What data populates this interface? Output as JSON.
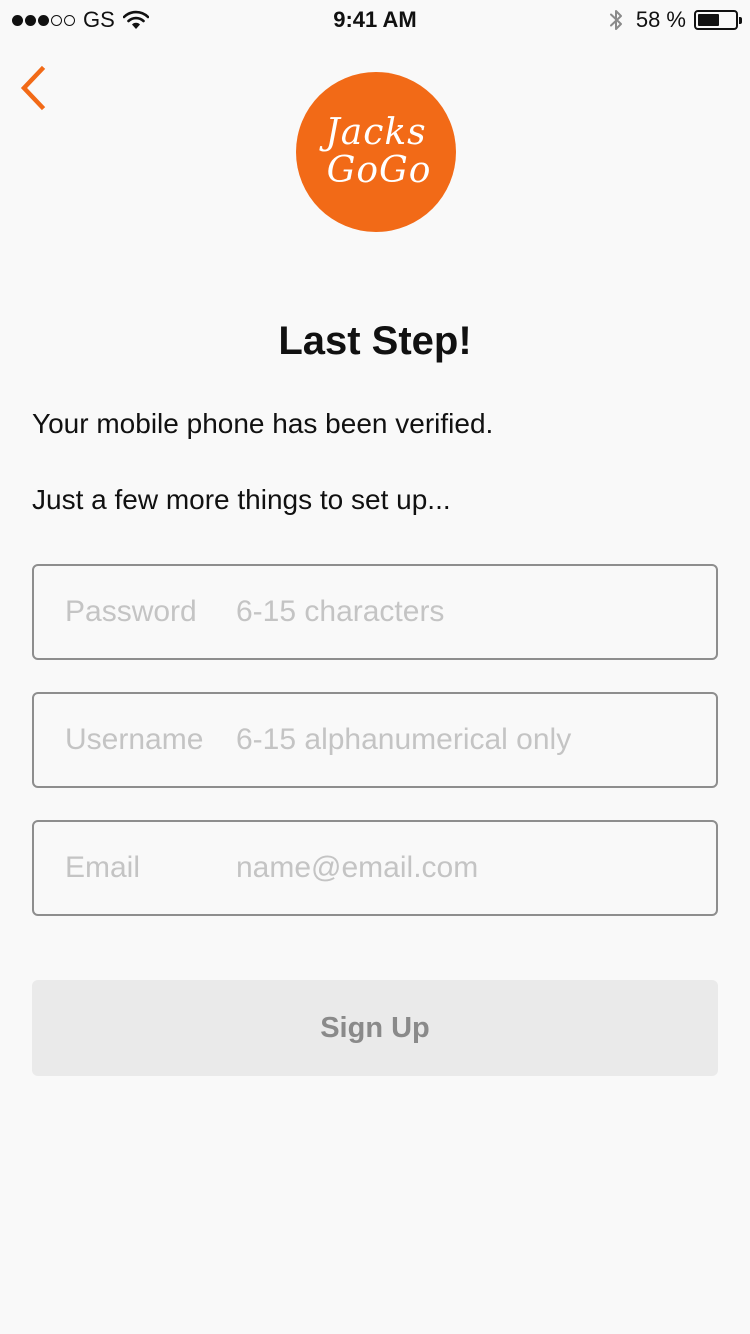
{
  "status_bar": {
    "signal": {
      "filled": 3,
      "total": 5
    },
    "carrier": "GS",
    "time": "9:41 AM",
    "battery_percent_text": "58 %",
    "battery_level": 0.58,
    "icons": [
      "wifi-icon",
      "bluetooth-icon",
      "battery-icon"
    ]
  },
  "nav": {
    "back_icon": "chevron-left-icon"
  },
  "logo": {
    "line1": "Jacks",
    "line2": "GoGo",
    "color": "#f26a17"
  },
  "main": {
    "title": "Last Step!",
    "line1": "Your mobile phone has been verified.",
    "line2": "Just a few more things to set up..."
  },
  "form": {
    "password": {
      "label": "Password",
      "placeholder": "6-15 characters",
      "value": ""
    },
    "username": {
      "label": "Username",
      "placeholder": "6-15 alphanumerical only",
      "value": ""
    },
    "email": {
      "label": "Email",
      "placeholder": "name@email.com",
      "value": ""
    },
    "submit_label": "Sign Up"
  },
  "colors": {
    "accent": "#f26a17",
    "background": "#f9f9f9",
    "button_disabled_bg": "#eaeaea",
    "button_disabled_text": "#8a8a8a",
    "field_border": "#8e8e8e",
    "placeholder": "#c4c4c4"
  }
}
